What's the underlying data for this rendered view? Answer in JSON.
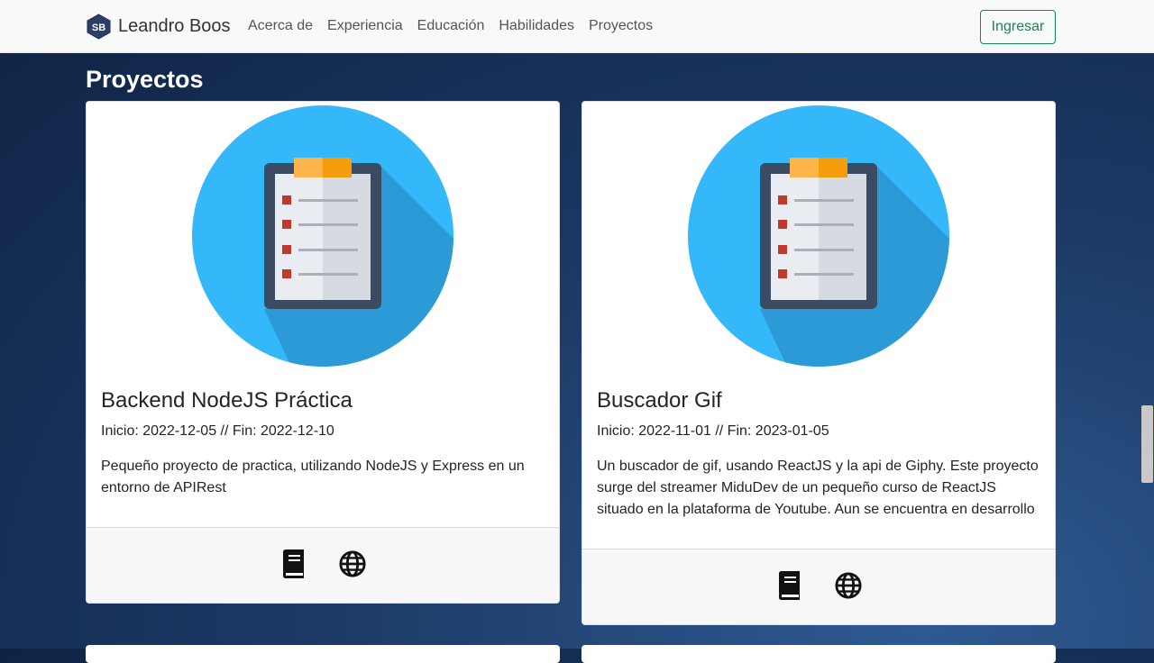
{
  "navbar": {
    "brand_initials": "SB",
    "brand_name": "Leandro Boos",
    "links": [
      "Acerca de",
      "Experiencia",
      "Educación",
      "Habilidades",
      "Proyectos"
    ],
    "login_label": "Ingresar"
  },
  "section": {
    "title": "Proyectos"
  },
  "projects": [
    {
      "title": "Backend NodeJS Práctica",
      "dates": "Inicio: 2022-12-05 // Fin: 2022-12-10",
      "description": "Pequeño proyecto de practica, utilizando NodeJS y Express en un entorno de APIRest",
      "image_icon": "clipboard-checklist-icon",
      "footer_icons": [
        "book-icon",
        "globe-icon"
      ]
    },
    {
      "title": "Buscador Gif",
      "dates": "Inicio: 2022-11-01 // Fin: 2023-01-05",
      "description": "Un buscador de gif, usando ReactJS y la api de Giphy. Este proyecto surge del streamer MiduDev de un pequeño curso de ReactJS situado en la plataforma de Youtube. Aun se encuentra en desarrollo",
      "image_icon": "clipboard-checklist-icon",
      "footer_icons": [
        "book-icon",
        "globe-icon"
      ]
    }
  ],
  "colors": {
    "accent_green": "#198754",
    "circle_blue": "#35b8f9",
    "clipboard_dark": "#3a4b63",
    "clip_orange": "#fca311",
    "bullet_red": "#c0392b"
  }
}
